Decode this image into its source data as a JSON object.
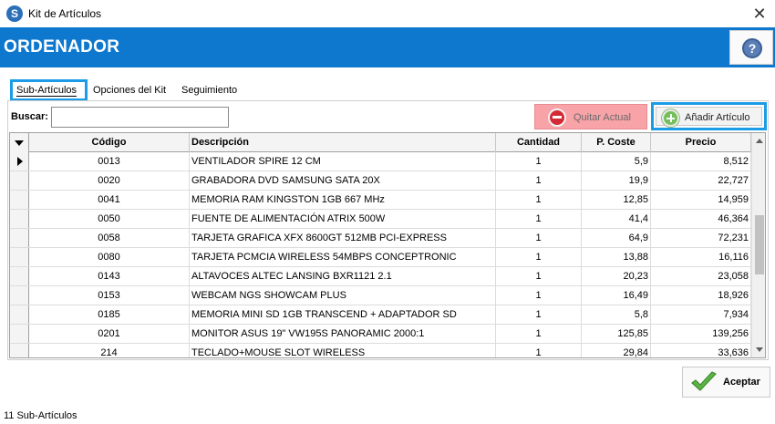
{
  "window": {
    "title": "Kit de Artículos",
    "app_icon": "S",
    "close_glyph": "✕"
  },
  "header": {
    "title": "ORDENADOR",
    "help_glyph": "?"
  },
  "tabs": [
    {
      "label": "Sub-Artículos",
      "active": true
    },
    {
      "label": "Opciones del Kit",
      "active": false
    },
    {
      "label": "Seguimiento",
      "active": false
    }
  ],
  "search": {
    "label": "Buscar:",
    "value": "",
    "placeholder": ""
  },
  "buttons": {
    "remove": "Quitar Actual",
    "add": "Añadir Artículo",
    "accept": "Aceptar"
  },
  "table": {
    "columns": [
      "Código",
      "Descripción",
      "Cantidad",
      "P. Coste",
      "Precio"
    ],
    "rows": [
      {
        "code": "0013",
        "desc": "VENTILADOR SPIRE 12 CM",
        "qty": "1",
        "cost": "5,9",
        "price": "8,512",
        "current": true
      },
      {
        "code": "0020",
        "desc": "GRABADORA DVD SAMSUNG SATA 20X",
        "qty": "1",
        "cost": "19,9",
        "price": "22,727",
        "current": false
      },
      {
        "code": "0041",
        "desc": "MEMORIA RAM KINGSTON 1GB 667 MHz",
        "qty": "1",
        "cost": "12,85",
        "price": "14,959",
        "current": false
      },
      {
        "code": "0050",
        "desc": "FUENTE DE ALIMENTACIÓN ATRIX 500W",
        "qty": "1",
        "cost": "41,4",
        "price": "46,364",
        "current": false
      },
      {
        "code": "0058",
        "desc": "TARJETA GRAFICA XFX 8600GT 512MB PCI-EXPRESS",
        "qty": "1",
        "cost": "64,9",
        "price": "72,231",
        "current": false
      },
      {
        "code": "0080",
        "desc": "TARJETA PCMCIA WIRELESS 54MBPS CONCEPTRONIC",
        "qty": "1",
        "cost": "13,88",
        "price": "16,116",
        "current": false
      },
      {
        "code": "0143",
        "desc": "ALTAVOCES ALTEC LANSING BXR1121 2.1",
        "qty": "1",
        "cost": "20,23",
        "price": "23,058",
        "current": false
      },
      {
        "code": "0153",
        "desc": "WEBCAM NGS SHOWCAM PLUS",
        "qty": "1",
        "cost": "16,49",
        "price": "18,926",
        "current": false
      },
      {
        "code": "0185",
        "desc": "MEMORIA MINI SD 1GB TRANSCEND + ADAPTADOR SD",
        "qty": "1",
        "cost": "5,8",
        "price": "7,934",
        "current": false
      },
      {
        "code": "0201",
        "desc": "MONITOR ASUS 19\" VW195S PANORAMIC 2000:1",
        "qty": "1",
        "cost": "125,85",
        "price": "139,256",
        "current": false
      },
      {
        "code": "214",
        "desc": "TECLADO+MOUSE SLOT WIRELESS",
        "qty": "1",
        "cost": "29,84",
        "price": "33,636",
        "current": false
      }
    ]
  },
  "status": "11 Sub-Artículos",
  "colors": {
    "header_bg": "#0e78cf",
    "focus_border": "#1a9ce6",
    "remove_bg": "#f7a3a8",
    "remove_icon": "#d42a35",
    "add_icon": "#74bf59",
    "accept_check": "#5bb544"
  },
  "icons": {
    "app": "app-logo-icon",
    "close": "close-icon",
    "help": "help-icon",
    "remove": "minus-circle-icon",
    "add": "plus-circle-icon",
    "accept": "checkmark-icon",
    "row_indicator": "current-row-arrow-icon",
    "sort": "sort-down-icon"
  }
}
